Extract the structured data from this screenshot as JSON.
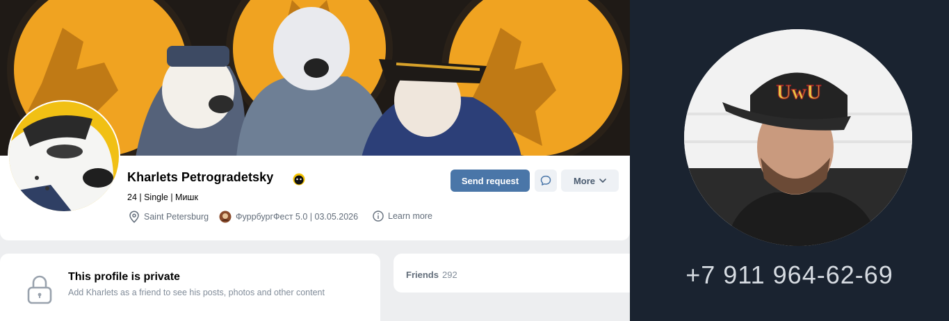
{
  "profile": {
    "name": "Kharlets Petrogradetsky",
    "subline": "24 | Single | Мишк",
    "location": "Saint Petersburg",
    "event": "ФуррбургФест 5.0 | 03.05.2026",
    "learn_more": "Learn more"
  },
  "actions": {
    "send_request": "Send request",
    "more": "More"
  },
  "private": {
    "title": "This profile is private",
    "description": "Add Kharlets as a friend to see his posts, photos and other content"
  },
  "friends": {
    "label": "Friends",
    "count": "292"
  },
  "side_panel": {
    "phone": "+7 911 964-62-69",
    "cap_text": "UwU"
  },
  "colors": {
    "accent": "#4a76a8",
    "cover_orange": "#f0a321",
    "side_bg": "#1a2330"
  }
}
